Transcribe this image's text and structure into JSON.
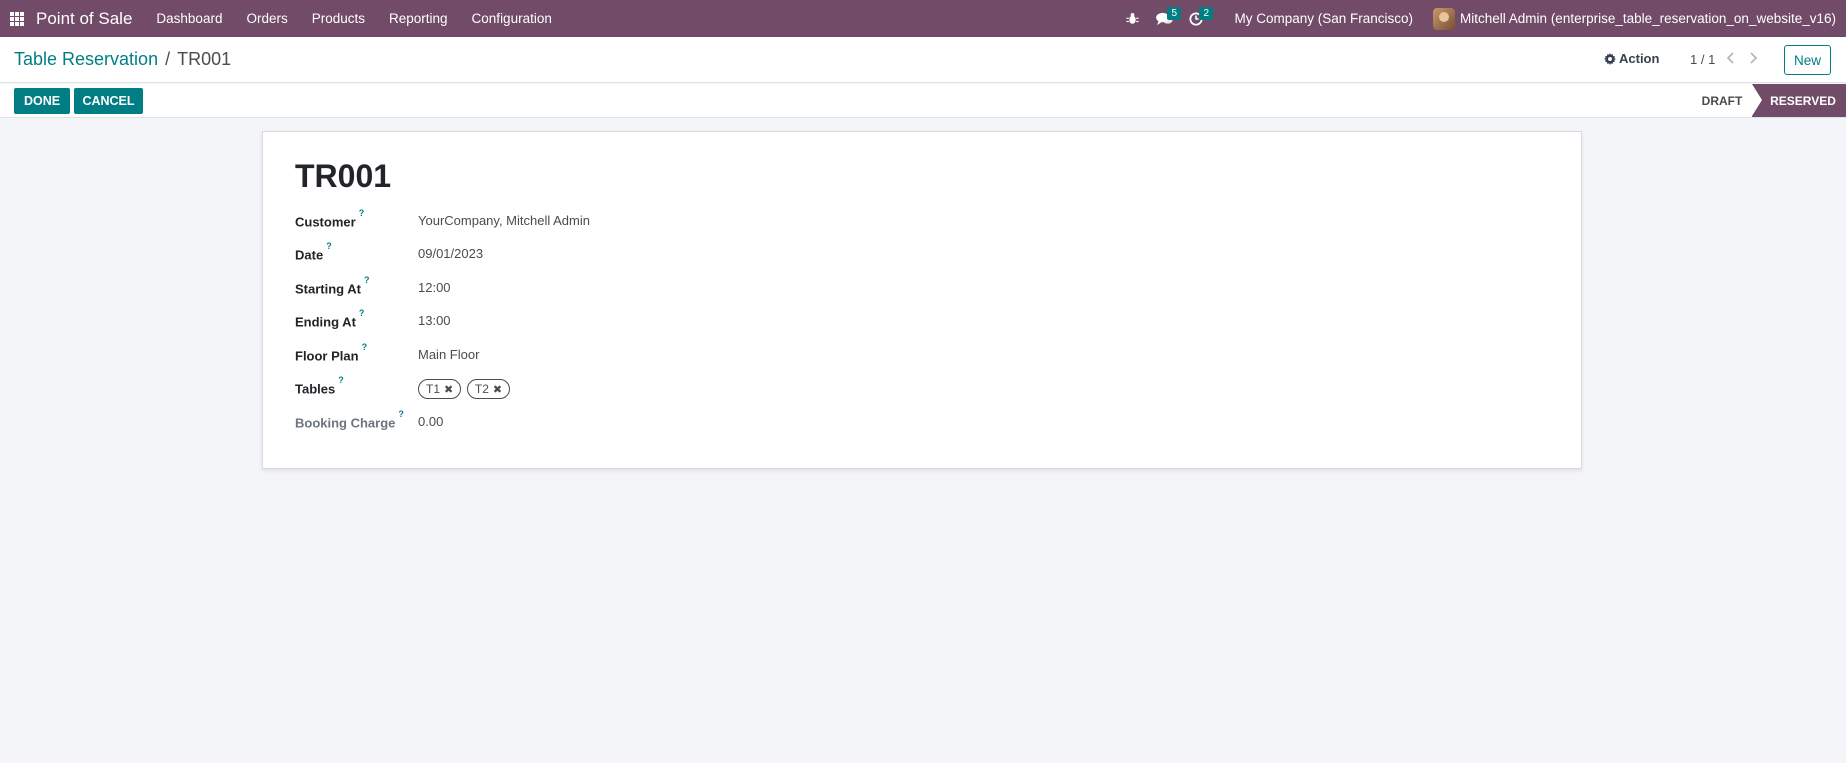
{
  "navbar": {
    "brand": "Point of Sale",
    "menu": [
      "Dashboard",
      "Orders",
      "Products",
      "Reporting",
      "Configuration"
    ],
    "messages_count": "5",
    "activities_count": "2",
    "company": "My Company (San Francisco)",
    "user": "Mitchell Admin (enterprise_table_reservation_on_website_v16)"
  },
  "control_panel": {
    "breadcrumb_parent": "Table Reservation",
    "breadcrumb_separator": "/",
    "breadcrumb_current": "TR001",
    "action_label": "Action",
    "pager": "1 / 1",
    "new_label": "New"
  },
  "statusbar": {
    "done_label": "DONE",
    "cancel_label": "CANCEL",
    "stages": [
      "DRAFT",
      "RESERVED"
    ],
    "active_stage": "RESERVED"
  },
  "form": {
    "title": "TR001",
    "fields": {
      "customer": {
        "label": "Customer",
        "value": "YourCompany, Mitchell Admin"
      },
      "date": {
        "label": "Date",
        "value": "09/01/2023"
      },
      "starting_at": {
        "label": "Starting At",
        "value": "12:00"
      },
      "ending_at": {
        "label": "Ending At",
        "value": "13:00"
      },
      "floor_plan": {
        "label": "Floor Plan",
        "value": "Main Floor"
      },
      "tables": {
        "label": "Tables",
        "tags": [
          "T1",
          "T2"
        ]
      },
      "booking_charge": {
        "label": "Booking Charge",
        "value": "0.00"
      }
    },
    "help_mark": "?"
  },
  "colors": {
    "primary": "#714b67",
    "accent": "#017e84"
  }
}
